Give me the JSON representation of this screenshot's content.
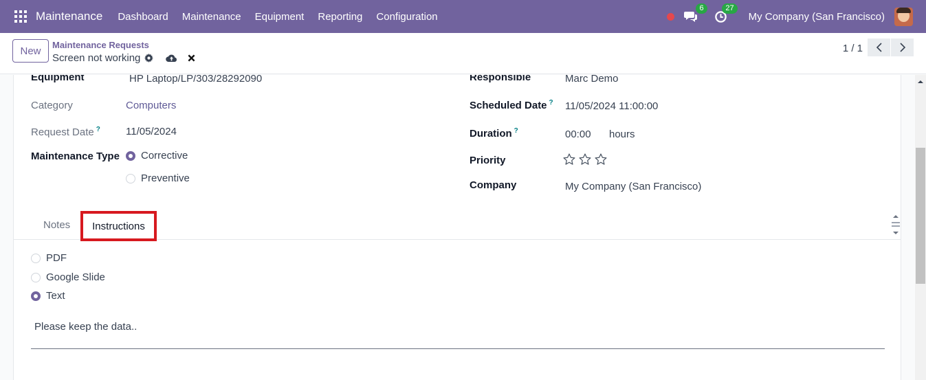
{
  "navbar": {
    "app_name": "Maintenance",
    "menu": [
      "Dashboard",
      "Maintenance",
      "Equipment",
      "Reporting",
      "Configuration"
    ],
    "messages_count": "6",
    "activities_count": "27",
    "company": "My Company (San Francisco)",
    "recording_color": "#e5484d",
    "badge_color": "#28a745",
    "brand_color": "#71639e"
  },
  "control": {
    "new_label": "New",
    "breadcrumb": "Maintenance Requests",
    "record_title": "Screen not working",
    "pager": "1 / 1"
  },
  "form": {
    "equipment_label": "Equipment",
    "equipment_value": "HP Laptop/LP/303/28292090",
    "category_label": "Category",
    "category_value": "Computers",
    "request_date_label": "Request Date",
    "request_date_value": "11/05/2024",
    "maintenance_type_label": "Maintenance Type",
    "maintenance_type_options": [
      "Corrective",
      "Preventive"
    ],
    "maintenance_type_selected": "Corrective",
    "responsible_label": "Responsible",
    "responsible_value": "Marc Demo",
    "scheduled_date_label": "Scheduled Date",
    "scheduled_date_value": "11/05/2024 11:00:00",
    "duration_label": "Duration",
    "duration_value": "00:00",
    "duration_unit": "hours",
    "priority_label": "Priority",
    "priority_stars_filled": 0,
    "priority_stars_total": 3,
    "company_label": "Company",
    "company_value": "My Company (San Francisco)",
    "help_mark": "?"
  },
  "tabs": {
    "notes": "Notes",
    "instructions": "Instructions",
    "active": "Instructions",
    "highlight_color": "#d7191f"
  },
  "instructions": {
    "options": [
      "PDF",
      "Google Slide",
      "Text"
    ],
    "selected": "Text",
    "text": "Please keep the data.."
  }
}
